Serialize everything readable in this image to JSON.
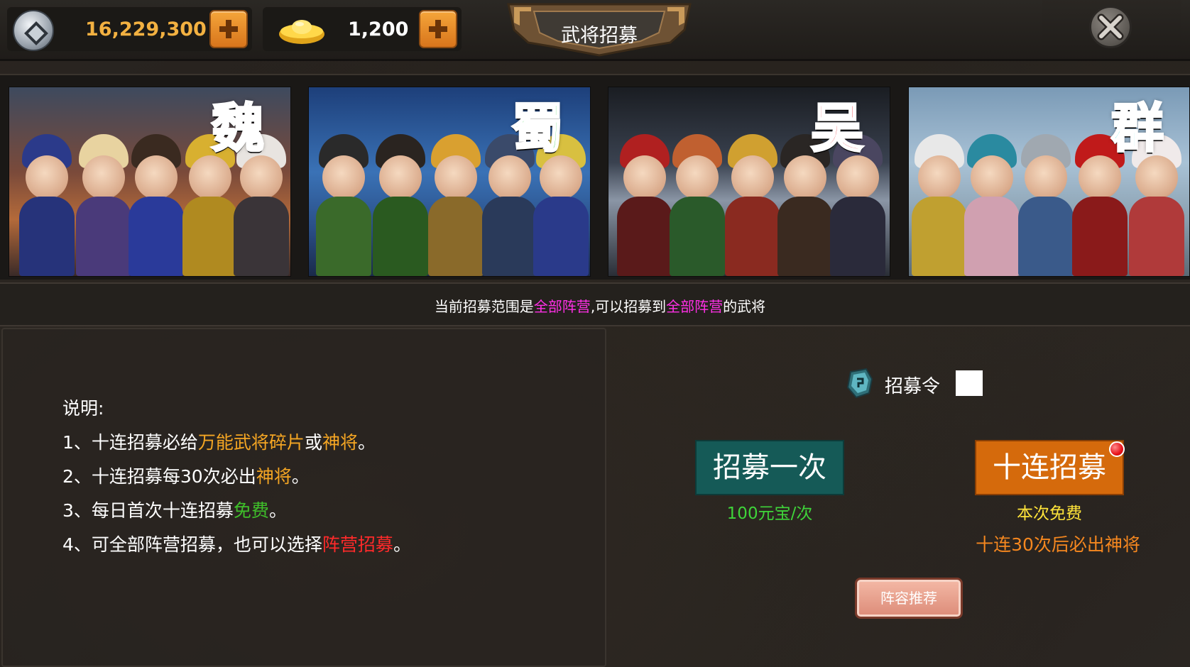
{
  "topbar": {
    "coins": {
      "value": "16,229,300",
      "icon": "silver-coin-icon",
      "add_icon": "plus-icon"
    },
    "gold": {
      "value": "1,200",
      "icon": "gold-ingot-icon",
      "add_icon": "plus-icon"
    },
    "title": "武将招募",
    "close_icon": "close-icon"
  },
  "factions": [
    {
      "name": "魏",
      "color": "#1d52e8"
    },
    {
      "name": "蜀",
      "color": "#12c825"
    },
    {
      "name": "吴",
      "color": "#e8131b"
    },
    {
      "name": "群",
      "color": "#16d8d0"
    }
  ],
  "info": {
    "part1": "当前招募范围是",
    "highlight1": "全部阵营",
    "part2": ",可以招募到",
    "highlight2": "全部阵营",
    "part3": "的武将"
  },
  "description": {
    "heading": "说明:",
    "line1": {
      "prefix": "1、十连招募必给",
      "hl1": "万能武将碎片",
      "mid": "或",
      "hl2": "神将",
      "suffix": "。"
    },
    "line2": {
      "prefix": "2、十连招募每30次必出",
      "hl": "神将",
      "suffix": "。"
    },
    "line3": {
      "prefix": "3、每日首次十连招募",
      "hl": "免费",
      "suffix": "。"
    },
    "line4": {
      "prefix": "4、可全部阵营招募，也可以选择",
      "hl": "阵营招募",
      "suffix": "。"
    }
  },
  "recruit": {
    "token_icon": "recruit-token-icon",
    "token_label": "招募令",
    "token_count": "",
    "once_label": "招募一次",
    "once_cost": "100元宝/次",
    "ten_label": "十连招募",
    "ten_cost": "本次免费",
    "guarantee": "十连30次后必出神将",
    "lineup_label": "阵容推荐"
  },
  "colors": {
    "accent_orange": "#f5a623",
    "highlight_magenta": "#ff2fe6",
    "free_green": "#3fbf2a",
    "alert_red": "#ff2a2a"
  }
}
